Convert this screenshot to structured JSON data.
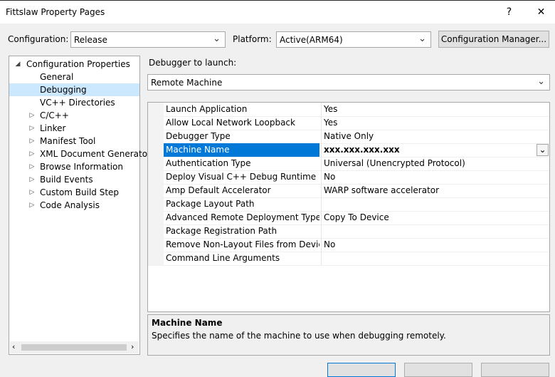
{
  "window": {
    "title": "Fittslaw Property Pages",
    "help_glyph": "?",
    "close_glyph": "✕"
  },
  "config_bar": {
    "configuration_label": "Configuration:",
    "configuration_value": "Release",
    "platform_label": "Platform:",
    "platform_value": "Active(ARM64)",
    "config_manager_label": "Configuration Manager..."
  },
  "tree": {
    "root": "Configuration Properties",
    "items": [
      {
        "label": "General"
      },
      {
        "label": "Debugging"
      },
      {
        "label": "VC++ Directories"
      },
      {
        "label": "C/C++"
      },
      {
        "label": "Linker"
      },
      {
        "label": "Manifest Tool"
      },
      {
        "label": "XML Document Generator"
      },
      {
        "label": "Browse Information"
      },
      {
        "label": "Build Events"
      },
      {
        "label": "Custom Build Step"
      },
      {
        "label": "Code Analysis"
      }
    ],
    "selected": "Debugging"
  },
  "debugger": {
    "label": "Debugger to launch:",
    "value": "Remote Machine"
  },
  "properties": [
    {
      "name": "Launch Application",
      "value": "Yes"
    },
    {
      "name": "Allow Local Network Loopback",
      "value": "Yes"
    },
    {
      "name": "Debugger Type",
      "value": "Native Only"
    },
    {
      "name": "Machine Name",
      "value": "xxx.xxx.xxx.xxx"
    },
    {
      "name": "Authentication Type",
      "value": "Universal (Unencrypted Protocol)"
    },
    {
      "name": "Deploy Visual C++ Debug Runtime Librari",
      "value": "No"
    },
    {
      "name": "Amp Default Accelerator",
      "value": "WARP software accelerator"
    },
    {
      "name": "Package Layout Path",
      "value": ""
    },
    {
      "name": "Advanced Remote Deployment Type",
      "value": "Copy To Device"
    },
    {
      "name": "Package Registration Path",
      "value": ""
    },
    {
      "name": "Remove Non-Layout Files from Device",
      "value": "No"
    },
    {
      "name": "Command Line Arguments",
      "value": ""
    }
  ],
  "selected_property": "Machine Name",
  "description": {
    "title": "Machine Name",
    "text": "Specifies the name of the machine to use when debugging remotely."
  },
  "colors": {
    "selection_blue": "#0078d7",
    "tree_selection": "#cce8ff"
  }
}
